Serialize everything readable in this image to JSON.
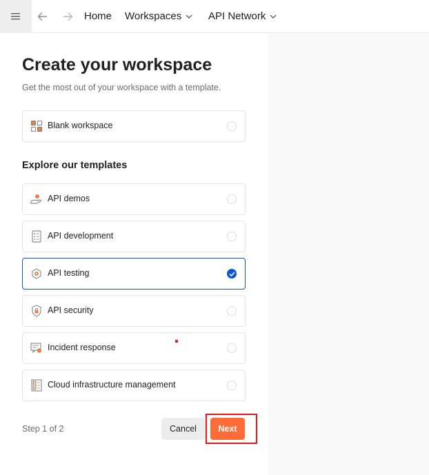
{
  "topbar": {
    "menu_icon": "hamburger-icon",
    "back_icon": "arrow-left-icon",
    "forward_icon": "arrow-right-icon",
    "home_label": "Home",
    "workspaces_label": "Workspaces",
    "api_network_label": "API Network"
  },
  "page": {
    "title": "Create your workspace",
    "subtitle": "Get the most out of your workspace with a template.",
    "blank_option": {
      "label": "Blank workspace",
      "icon": "grid-icon",
      "selected": false
    },
    "templates_heading": "Explore our templates",
    "templates": [
      {
        "label": "API demos",
        "icon": "hand-coin-icon",
        "selected": false
      },
      {
        "label": "API development",
        "icon": "document-checklist-icon",
        "selected": false
      },
      {
        "label": "API testing",
        "icon": "hexagon-gear-icon",
        "selected": true
      },
      {
        "label": "API security",
        "icon": "shield-lock-icon",
        "selected": false
      },
      {
        "label": "Incident response",
        "icon": "alert-document-icon",
        "selected": false
      },
      {
        "label": "Cloud infrastructure management",
        "icon": "server-rack-icon",
        "selected": false
      }
    ]
  },
  "footer": {
    "step_text": "Step 1 of 2",
    "cancel_label": "Cancel",
    "next_label": "Next"
  },
  "colors": {
    "accent_orange": "#ff6c37",
    "selection_blue": "#0b57d0",
    "icon_orange": "#e8804a",
    "highlight_red": "#e8141a"
  }
}
